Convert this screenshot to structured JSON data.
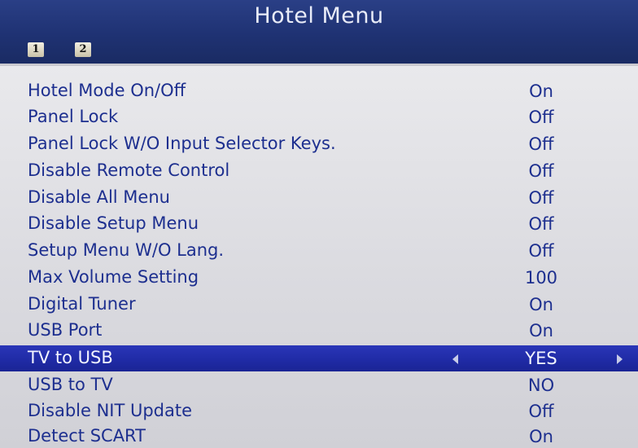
{
  "header": {
    "title": "Hotel Menu",
    "pages": [
      "1",
      "2"
    ]
  },
  "menu": {
    "items": [
      {
        "label": "Hotel Mode On/Off",
        "value": "On"
      },
      {
        "label": "Panel Lock",
        "value": "Off"
      },
      {
        "label": "Panel Lock W/O Input Selector Keys.",
        "value": "Off"
      },
      {
        "label": "Disable Remote Control",
        "value": "Off"
      },
      {
        "label": "Disable All Menu",
        "value": "Off"
      },
      {
        "label": "Disable Setup Menu",
        "value": "Off"
      },
      {
        "label": "Setup Menu W/O Lang.",
        "value": "Off"
      },
      {
        "label": "Max Volume Setting",
        "value": "100"
      },
      {
        "label": "Digital Tuner",
        "value": "On"
      },
      {
        "label": "USB Port",
        "value": "On"
      },
      {
        "label": "TV to USB",
        "value": "YES",
        "selected": true
      },
      {
        "label": "USB to TV",
        "value": "NO"
      },
      {
        "label": "Disable NIT Update",
        "value": "Off"
      },
      {
        "label": "Detect SCART",
        "value": "On"
      }
    ]
  },
  "icons": {
    "prev": "arrow-left-icon",
    "next": "arrow-right-icon"
  },
  "colors": {
    "header_bg": "#1f3273",
    "panel_bg": "#dcdce1",
    "text": "#1d2f8f",
    "selection_bg": "#1f2aa4"
  }
}
